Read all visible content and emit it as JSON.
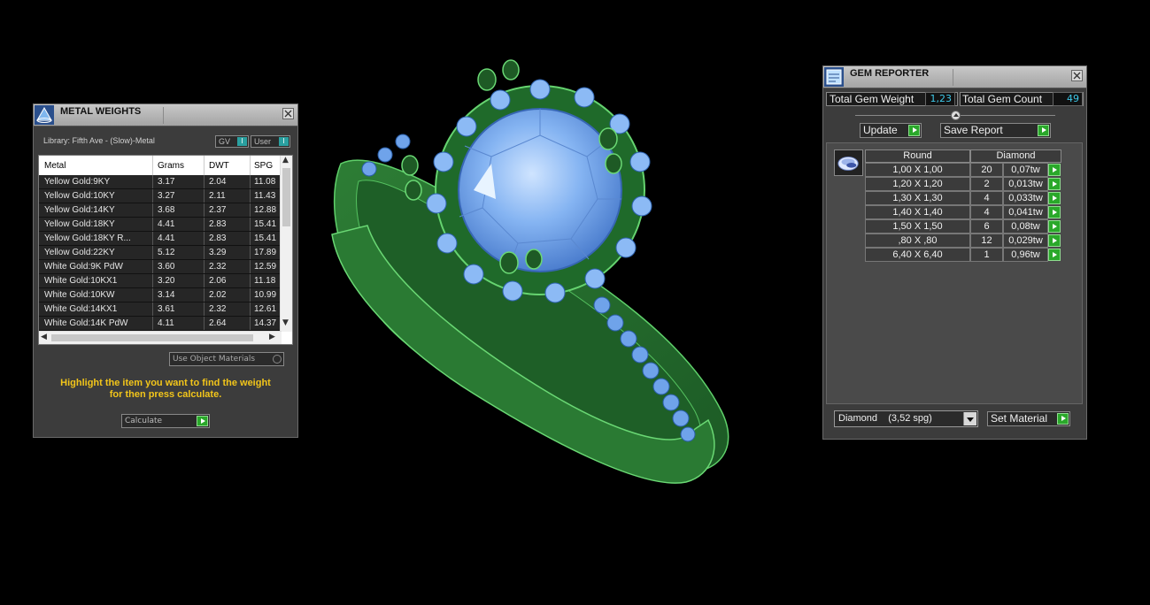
{
  "metal_weights": {
    "title": "METAL WEIGHTS",
    "library": "Library: Fifth Ave - (Slow)-Metal",
    "gv_label": "GV",
    "user_label": "User",
    "toggle_glyph": "I",
    "columns": [
      "Metal",
      "Grams",
      "DWT",
      "SPG"
    ],
    "rows": [
      [
        "Yellow Gold:9KY",
        "3.17",
        "2.04",
        "11.08"
      ],
      [
        "Yellow Gold:10KY",
        "3.27",
        "2.11",
        "11.43"
      ],
      [
        "Yellow Gold:14KY",
        "3.68",
        "2.37",
        "12.88"
      ],
      [
        "Yellow Gold:18KY",
        "4.41",
        "2.83",
        "15.41"
      ],
      [
        "Yellow Gold:18KY R...",
        "4.41",
        "2.83",
        "15.41"
      ],
      [
        "Yellow Gold:22KY",
        "5.12",
        "3.29",
        "17.89"
      ],
      [
        "White Gold:9K PdW",
        "3.60",
        "2.32",
        "12.59"
      ],
      [
        "White Gold:10KX1",
        "3.20",
        "2.06",
        "11.18"
      ],
      [
        "White Gold:10KW",
        "3.14",
        "2.02",
        "10.99"
      ],
      [
        "White Gold:14KX1",
        "3.61",
        "2.32",
        "12.61"
      ],
      [
        "White Gold:14K PdW",
        "4.11",
        "2.64",
        "14.37"
      ]
    ],
    "use_object_materials": "Use Object Materials",
    "hint_line1": "Highlight the item you want to find the weight",
    "hint_line2": "for then press calculate.",
    "calculate": "Calculate"
  },
  "gem_reporter": {
    "title": "GEM REPORTER",
    "total_gem_weight_label": "Total Gem Weight",
    "total_gem_weight": "1,23",
    "total_gem_count_label": "Total Gem Count",
    "total_gem_count": "49",
    "update": "Update",
    "save_report": "Save Report",
    "shape_header": "Round",
    "type_header": "Diamond",
    "gems": [
      [
        "1,00 X 1,00",
        "20",
        "0,07tw"
      ],
      [
        "1,20 X 1,20",
        "2",
        "0,013tw"
      ],
      [
        "1,30 X 1,30",
        "4",
        "0,033tw"
      ],
      [
        "1,40 X 1,40",
        "4",
        "0,041tw"
      ],
      [
        "1,50 X 1,50",
        "6",
        "0,08tw"
      ],
      [
        ",80 X ,80",
        "12",
        "0,029tw"
      ],
      [
        "6,40 X 6,40",
        "1",
        "0,96tw"
      ]
    ],
    "material": "Diamond    (3,52 spg)",
    "set_material": "Set Material"
  },
  "colors": {
    "ring_green": "#2f8a3a",
    "gem_blue": "#7fb2f0",
    "hint_yellow": "#f2c51a",
    "value_cyan": "#3ec8e8",
    "arrow_green": "#2aa82a"
  }
}
